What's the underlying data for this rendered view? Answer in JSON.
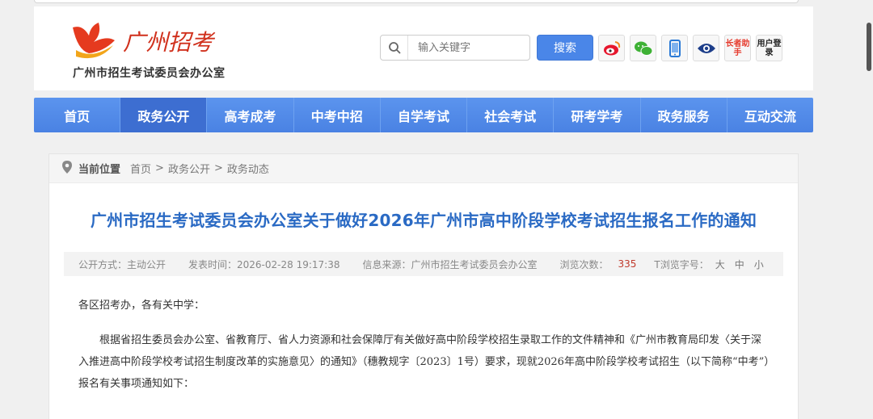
{
  "site": {
    "logo_text": "广州招考",
    "subtitle": "广州市招生考试委员会办公室"
  },
  "search": {
    "placeholder": "输入关键字",
    "button_label": "搜索"
  },
  "header_icons": [
    {
      "name": "weibo-icon"
    },
    {
      "name": "wechat-icon"
    },
    {
      "name": "mobile-icon"
    },
    {
      "name": "eye-icon"
    },
    {
      "name": "elder-assist-icon",
      "text": "长者助手"
    },
    {
      "name": "user-login-icon",
      "text": "用户登录"
    }
  ],
  "nav": {
    "items": [
      "首页",
      "政务公开",
      "高考成考",
      "中考中招",
      "自学考试",
      "社会考试",
      "研考学考",
      "政务服务",
      "互动交流"
    ],
    "active_index": 1
  },
  "breadcrumb": {
    "label": "当前位置",
    "items": [
      "首页",
      "政务公开",
      "政务动态"
    ],
    "separator": ">"
  },
  "article": {
    "title": "广州市招生考试委员会办公室关于做好2026年广州市高中阶段学校考试招生报名工作的通知",
    "meta": {
      "disclosure": "公开方式：主动公开",
      "publish_time": "发表时间：2026-02-28 19:17:38",
      "source": "信息来源：广州市招生考试委员会办公室",
      "views_label": "浏览次数：",
      "views_count": "335",
      "font_size_label": "T浏览字号：",
      "font_sizes": [
        "大",
        "中",
        "小"
      ]
    },
    "greeting": "各区招考办，各有关中学：",
    "paragraph1": "根据省招生委员会办公室、省教育厅、省人力资源和社会保障厅有关做好高中阶段学校招生录取工作的文件精神和《广州市教育局印发〈关于深入推进高中阶段学校考试招生制度改革的实施意见〉的通知》（穗教规字〔2023〕1号）要求，现就2026年高中阶段学校考试招生（以下简称“中考”）报名有关事项通知如下："
  },
  "colors": {
    "nav_bg": "#4a82e3",
    "nav_active": "#3d6ed1",
    "title": "#2a6ac4",
    "views_count": "#c0392b"
  }
}
